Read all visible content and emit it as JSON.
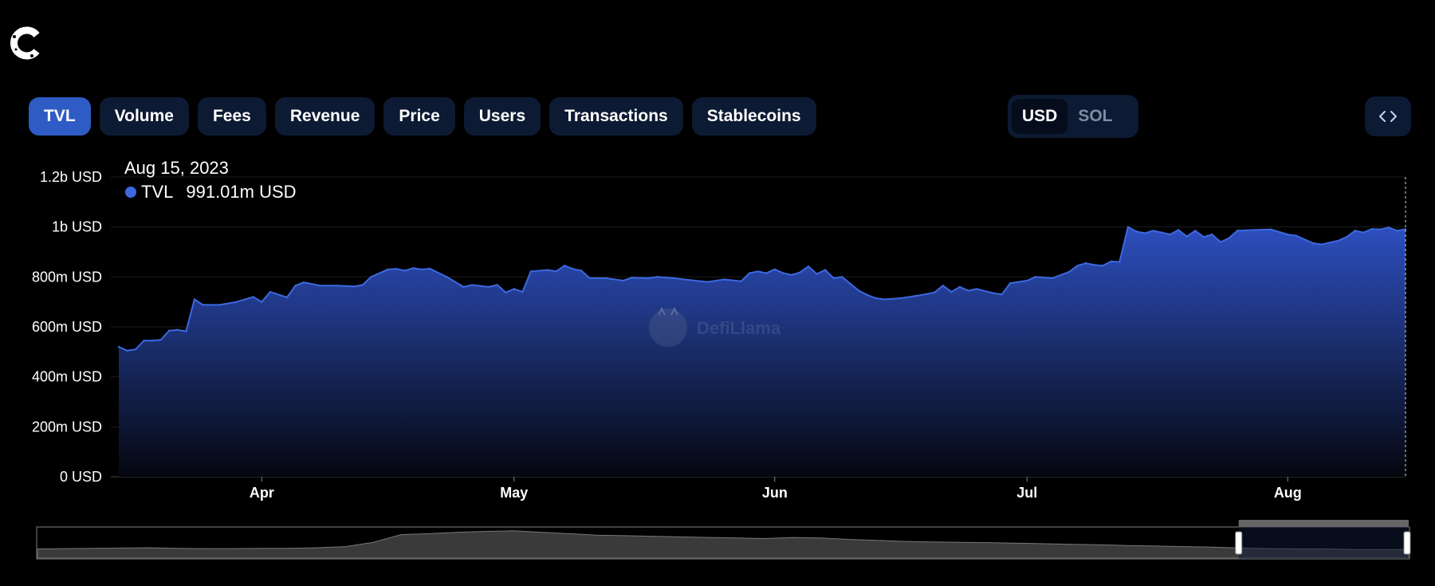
{
  "tabs": [
    {
      "label": "TVL",
      "active": true
    },
    {
      "label": "Volume"
    },
    {
      "label": "Fees"
    },
    {
      "label": "Revenue"
    },
    {
      "label": "Price"
    },
    {
      "label": "Users"
    },
    {
      "label": "Transactions"
    },
    {
      "label": "Stablecoins"
    }
  ],
  "currency": {
    "options": [
      "USD",
      "SOL"
    ],
    "selected": "USD"
  },
  "embed_icon": "code-icon",
  "logo_icon": "c-logo-icon",
  "tooltip": {
    "date": "Aug 15, 2023",
    "series": "TVL",
    "value": "991.01m USD",
    "color": "#3d68e0"
  },
  "watermark": "DefiLlama",
  "colors": {
    "line": "#3d68e0",
    "fill_top": "#2d4fbf",
    "fill_bottom": "#05070f",
    "active_tab": "#2f5bc4",
    "tab": "#0d1a33"
  },
  "chart_data": {
    "type": "area",
    "series": [
      {
        "name": "TVL",
        "unit": "USD"
      }
    ],
    "ylim": [
      0,
      1200000000
    ],
    "yticks": [
      {
        "v": 0,
        "label": "0 USD"
      },
      {
        "v": 200000000,
        "label": "200m USD"
      },
      {
        "v": 400000000,
        "label": "400m USD"
      },
      {
        "v": 600000000,
        "label": "600m USD"
      },
      {
        "v": 800000000,
        "label": "800m USD"
      },
      {
        "v": 1000000000,
        "label": "1b USD"
      },
      {
        "v": 1200000000,
        "label": "1.2b USD"
      }
    ],
    "xlim": [
      "2023-03-15",
      "2023-08-15"
    ],
    "xticks": [
      {
        "date": "2023-04-01",
        "label": "Apr"
      },
      {
        "date": "2023-05-01",
        "label": "May"
      },
      {
        "date": "2023-06-01",
        "label": "Jun"
      },
      {
        "date": "2023-07-01",
        "label": "Jul"
      },
      {
        "date": "2023-08-01",
        "label": "Aug"
      }
    ],
    "points": [
      [
        "2023-03-15",
        520000000
      ],
      [
        "2023-03-16",
        505000000
      ],
      [
        "2023-03-17",
        510000000
      ],
      [
        "2023-03-18",
        545000000
      ],
      [
        "2023-03-19",
        545000000
      ],
      [
        "2023-03-20",
        548000000
      ],
      [
        "2023-03-21",
        585000000
      ],
      [
        "2023-03-22",
        588000000
      ],
      [
        "2023-03-23",
        582000000
      ],
      [
        "2023-03-24",
        710000000
      ],
      [
        "2023-03-25",
        688000000
      ],
      [
        "2023-03-27",
        688000000
      ],
      [
        "2023-03-29",
        700000000
      ],
      [
        "2023-03-31",
        720000000
      ],
      [
        "2023-04-01",
        700000000
      ],
      [
        "2023-04-02",
        740000000
      ],
      [
        "2023-04-04",
        718000000
      ],
      [
        "2023-04-05",
        765000000
      ],
      [
        "2023-04-06",
        778000000
      ],
      [
        "2023-04-08",
        765000000
      ],
      [
        "2023-04-10",
        765000000
      ],
      [
        "2023-04-12",
        762000000
      ],
      [
        "2023-04-13",
        768000000
      ],
      [
        "2023-04-14",
        800000000
      ],
      [
        "2023-04-16",
        830000000
      ],
      [
        "2023-04-17",
        832000000
      ],
      [
        "2023-04-18",
        825000000
      ],
      [
        "2023-04-19",
        835000000
      ],
      [
        "2023-04-20",
        830000000
      ],
      [
        "2023-04-21",
        833000000
      ],
      [
        "2023-04-23",
        800000000
      ],
      [
        "2023-04-25",
        760000000
      ],
      [
        "2023-04-26",
        768000000
      ],
      [
        "2023-04-28",
        760000000
      ],
      [
        "2023-04-29",
        768000000
      ],
      [
        "2023-04-30",
        738000000
      ],
      [
        "2023-05-01",
        752000000
      ],
      [
        "2023-05-02",
        740000000
      ],
      [
        "2023-05-03",
        822000000
      ],
      [
        "2023-05-05",
        828000000
      ],
      [
        "2023-05-06",
        822000000
      ],
      [
        "2023-05-07",
        845000000
      ],
      [
        "2023-05-08",
        832000000
      ],
      [
        "2023-05-09",
        825000000
      ],
      [
        "2023-05-10",
        795000000
      ],
      [
        "2023-05-12",
        795000000
      ],
      [
        "2023-05-14",
        785000000
      ],
      [
        "2023-05-15",
        797000000
      ],
      [
        "2023-05-17",
        795000000
      ],
      [
        "2023-05-18",
        800000000
      ],
      [
        "2023-05-20",
        795000000
      ],
      [
        "2023-05-22",
        787000000
      ],
      [
        "2023-05-24",
        780000000
      ],
      [
        "2023-05-26",
        790000000
      ],
      [
        "2023-05-28",
        783000000
      ],
      [
        "2023-05-29",
        815000000
      ],
      [
        "2023-05-30",
        822000000
      ],
      [
        "2023-05-31",
        815000000
      ],
      [
        "2023-06-01",
        830000000
      ],
      [
        "2023-06-02",
        815000000
      ],
      [
        "2023-06-03",
        808000000
      ],
      [
        "2023-06-04",
        818000000
      ],
      [
        "2023-06-05",
        842000000
      ],
      [
        "2023-06-06",
        812000000
      ],
      [
        "2023-06-07",
        828000000
      ],
      [
        "2023-06-08",
        795000000
      ],
      [
        "2023-06-09",
        800000000
      ],
      [
        "2023-06-11",
        745000000
      ],
      [
        "2023-06-12",
        728000000
      ],
      [
        "2023-06-13",
        715000000
      ],
      [
        "2023-06-14",
        710000000
      ],
      [
        "2023-06-16",
        715000000
      ],
      [
        "2023-06-18",
        725000000
      ],
      [
        "2023-06-20",
        738000000
      ],
      [
        "2023-06-21",
        765000000
      ],
      [
        "2023-06-22",
        740000000
      ],
      [
        "2023-06-23",
        760000000
      ],
      [
        "2023-06-24",
        745000000
      ],
      [
        "2023-06-25",
        752000000
      ],
      [
        "2023-06-27",
        735000000
      ],
      [
        "2023-06-28",
        730000000
      ],
      [
        "2023-06-29",
        775000000
      ],
      [
        "2023-07-01",
        785000000
      ],
      [
        "2023-07-02",
        800000000
      ],
      [
        "2023-07-04",
        795000000
      ],
      [
        "2023-07-06",
        820000000
      ],
      [
        "2023-07-07",
        845000000
      ],
      [
        "2023-07-08",
        855000000
      ],
      [
        "2023-07-09",
        848000000
      ],
      [
        "2023-07-10",
        845000000
      ],
      [
        "2023-07-11",
        862000000
      ],
      [
        "2023-07-12",
        860000000
      ],
      [
        "2023-07-13",
        1000000000
      ],
      [
        "2023-07-14",
        982000000
      ],
      [
        "2023-07-15",
        975000000
      ],
      [
        "2023-07-16",
        985000000
      ],
      [
        "2023-07-17",
        978000000
      ],
      [
        "2023-07-18",
        970000000
      ],
      [
        "2023-07-19",
        988000000
      ],
      [
        "2023-07-20",
        962000000
      ],
      [
        "2023-07-21",
        985000000
      ],
      [
        "2023-07-22",
        960000000
      ],
      [
        "2023-07-23",
        970000000
      ],
      [
        "2023-07-24",
        940000000
      ],
      [
        "2023-07-25",
        955000000
      ],
      [
        "2023-07-26",
        985000000
      ],
      [
        "2023-07-28",
        988000000
      ],
      [
        "2023-07-30",
        990000000
      ],
      [
        "2023-08-01",
        970000000
      ],
      [
        "2023-08-02",
        965000000
      ],
      [
        "2023-08-04",
        935000000
      ],
      [
        "2023-08-05",
        930000000
      ],
      [
        "2023-08-07",
        945000000
      ],
      [
        "2023-08-08",
        960000000
      ],
      [
        "2023-08-09",
        985000000
      ],
      [
        "2023-08-10",
        978000000
      ],
      [
        "2023-08-11",
        992000000
      ],
      [
        "2023-08-12",
        990000000
      ],
      [
        "2023-08-13",
        998000000
      ],
      [
        "2023-08-14",
        985000000
      ],
      [
        "2023-08-15",
        991010000
      ]
    ],
    "overview": {
      "type": "area",
      "values": [
        0.32,
        0.33,
        0.34,
        0.35,
        0.36,
        0.34,
        0.33,
        0.33,
        0.34,
        0.34,
        0.36,
        0.4,
        0.55,
        0.82,
        0.85,
        0.9,
        0.93,
        0.95,
        0.9,
        0.85,
        0.8,
        0.78,
        0.76,
        0.74,
        0.72,
        0.7,
        0.68,
        0.72,
        0.7,
        0.65,
        0.62,
        0.58,
        0.56,
        0.55,
        0.54,
        0.52,
        0.5,
        0.48,
        0.46,
        0.44,
        0.42,
        0.4,
        0.38,
        0.35,
        0.33,
        0.32,
        0.32,
        0.3,
        0.3,
        0.3
      ],
      "selected_window": [
        0.876,
        1.0
      ]
    }
  }
}
